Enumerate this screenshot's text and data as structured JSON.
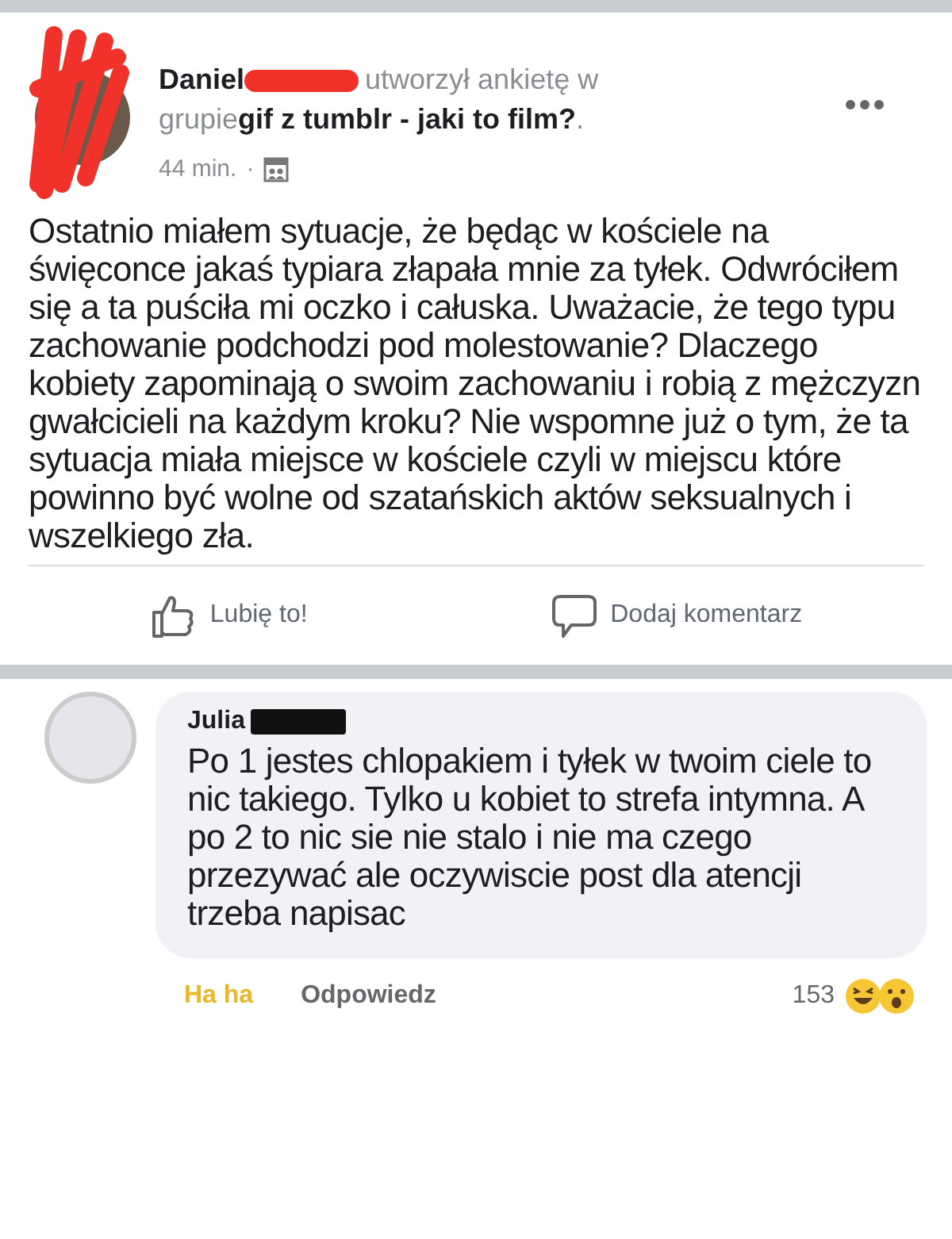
{
  "post": {
    "author": "Daniel",
    "action": "utworzył ankietę w",
    "in_group": "grupie",
    "group": "gif z tumblr - jaki to film?",
    "group_suffix": ".",
    "time": "44 min.",
    "separator": "·",
    "body": "Ostatnio miałem sytuacje, że będąc w kościele na święconce jakaś typiara złapała mnie za tyłek. Odwróciłem się a ta puściła mi oczko i całuska. Uważacie, że tego typu zachowanie podchodzi pod molestowanie? Dlaczego kobiety zapominają o swoim zachowaniu i robią z mężczyzn gwałcicieli na każdym kroku? Nie wspomne już o tym, że ta sytuacja miała miejsce w kościele czyli w miejscu które powinno być wolne od szatańskich aktów seksualnych i wszelkiego zła.",
    "actions": [
      {
        "kind": "like",
        "label": "Lubię to!"
      },
      {
        "kind": "comment",
        "label": "Dodaj komentarz"
      }
    ]
  },
  "comment": {
    "author": "Julia",
    "text": "Po 1 jestes chlopakiem i tyłek w twoim ciele to nic takiego. Tylko u kobiet to strefa intymna. A po 2 to nic sie nie stalo i nie ma czego przezywać ale oczywiscie post dla atencji trzeba napisac",
    "reaction": {
      "label": "Ha ha",
      "selected": true
    },
    "reply": "Odpowiedz",
    "reaction_count": "153"
  }
}
